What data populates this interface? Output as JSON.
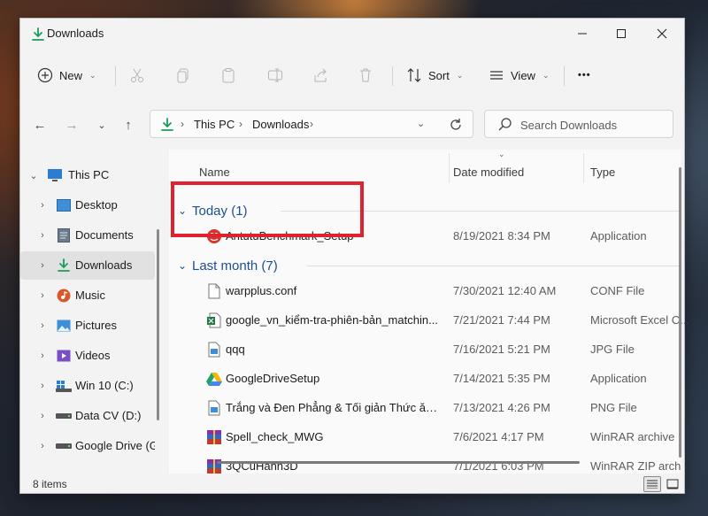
{
  "window": {
    "title": "Downloads"
  },
  "toolbar": {
    "new_label": "New",
    "sort_label": "Sort",
    "view_label": "View",
    "more_label": "•••"
  },
  "address": {
    "crumbs": [
      "This PC",
      "Downloads"
    ]
  },
  "search": {
    "placeholder": "Search Downloads"
  },
  "sidebar": {
    "items": [
      {
        "label": "This PC",
        "icon": "monitor-icon"
      },
      {
        "label": "Desktop",
        "icon": "desktop-icon"
      },
      {
        "label": "Documents",
        "icon": "documents-icon"
      },
      {
        "label": "Downloads",
        "icon": "download-icon",
        "selected": true
      },
      {
        "label": "Music",
        "icon": "music-icon"
      },
      {
        "label": "Pictures",
        "icon": "pictures-icon"
      },
      {
        "label": "Videos",
        "icon": "videos-icon"
      },
      {
        "label": "Win 10 (C:)",
        "icon": "windows-drive-icon"
      },
      {
        "label": "Data CV (D:)",
        "icon": "drive-icon"
      },
      {
        "label": "Google Drive (G",
        "icon": "drive-icon"
      }
    ]
  },
  "columns": {
    "name": "Name",
    "date": "Date modified",
    "type": "Type"
  },
  "groups": [
    {
      "label": "Today (1)",
      "files": [
        {
          "name": "AntutuBenchmark_Setup",
          "date": "8/19/2021 8:34 PM",
          "type": "Application",
          "icon": "antutu-icon"
        }
      ]
    },
    {
      "label": "Last month (7)",
      "files": [
        {
          "name": "warpplus.conf",
          "date": "7/30/2021 12:40 AM",
          "type": "CONF File",
          "icon": "file-icon"
        },
        {
          "name": "google_vn_kiểm-tra-phiên-bản_matchin...",
          "date": "7/21/2021 7:44 PM",
          "type": "Microsoft Excel C...",
          "icon": "excel-icon"
        },
        {
          "name": "qqq",
          "date": "7/16/2021 5:21 PM",
          "type": "JPG File",
          "icon": "image-icon"
        },
        {
          "name": "GoogleDriveSetup",
          "date": "7/14/2021 5:35 PM",
          "type": "Application",
          "icon": "google-drive-icon"
        },
        {
          "name": "Trắng và Đen Phẳng & Tối giản Thức ăn ...",
          "date": "7/13/2021 4:26 PM",
          "type": "PNG File",
          "icon": "image-icon"
        },
        {
          "name": "Spell_check_MWG",
          "date": "7/6/2021 4:17 PM",
          "type": "WinRAR archive",
          "icon": "winrar-icon"
        },
        {
          "name": "3QCuHanh3D",
          "date": "7/1/2021 6:03 PM",
          "type": "WinRAR ZIP archive",
          "icon": "winrar-icon"
        }
      ]
    }
  ],
  "status": {
    "item_count": "8 items"
  },
  "colors": {
    "accent": "#1b4f93",
    "highlight": "#e02230",
    "download_green": "#1a9c5a"
  }
}
